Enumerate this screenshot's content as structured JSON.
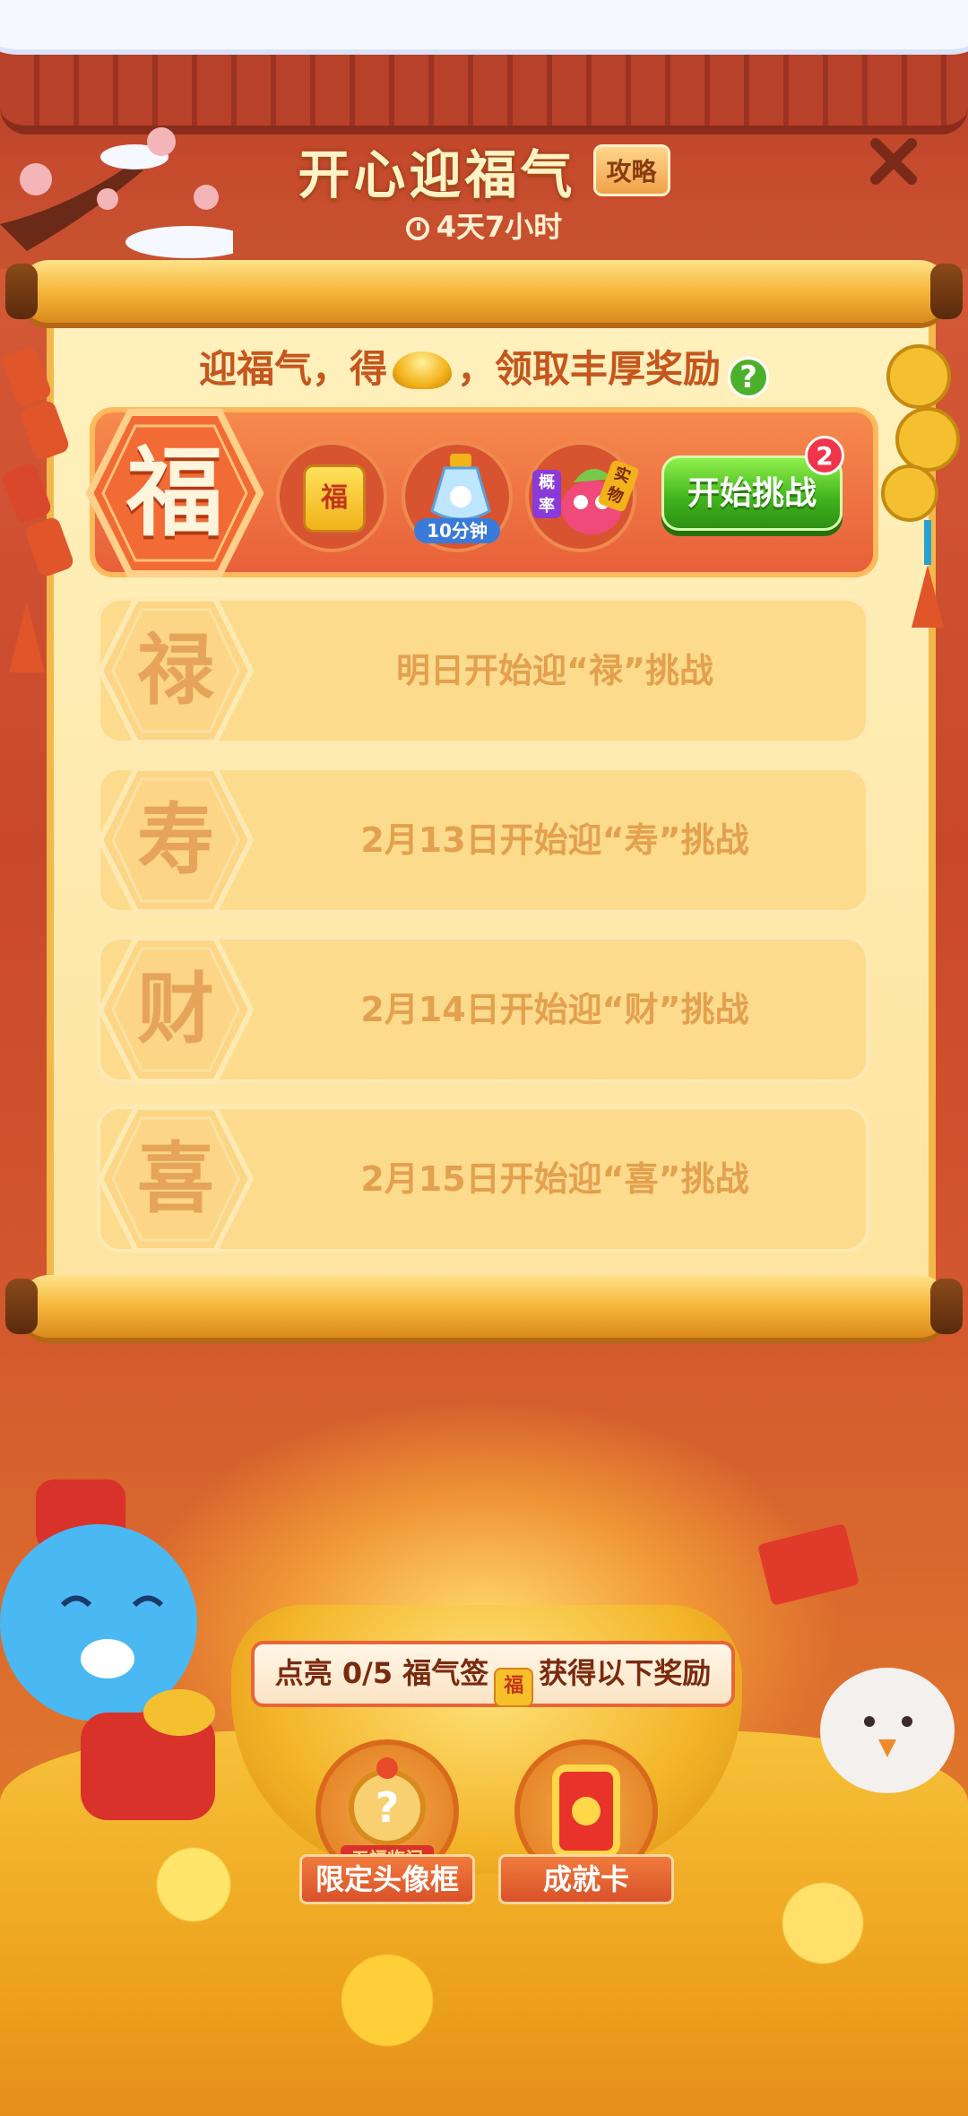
{
  "header": {
    "title": "开心迎福气",
    "guide_label": "攻略",
    "timer": "4天7小时",
    "close_icon": "close-icon"
  },
  "scroll": {
    "subtitle_before": "迎福气，得",
    "subtitle_after": "，领取丰厚奖励",
    "help_label": "?"
  },
  "active_challenge": {
    "character": "福",
    "rewards": [
      {
        "icon": "fu-card-icon",
        "label": "福"
      },
      {
        "icon": "potion-icon",
        "label": "10分钟"
      },
      {
        "icon": "lucky-chance-icon",
        "label_a": "概率",
        "label_b": "实物"
      }
    ],
    "start_button": "开始挑战",
    "badge_count": "2"
  },
  "upcoming": [
    {
      "character": "禄",
      "text": "明日开始迎“禄”挑战"
    },
    {
      "character": "寿",
      "text": "2月13日开始迎“寿”挑战"
    },
    {
      "character": "财",
      "text": "2月14日开始迎“财”挑战"
    },
    {
      "character": "喜",
      "text": "2月15日开始迎“喜”挑战"
    }
  ],
  "progress": {
    "prefix": "点亮",
    "count": "0/5",
    "item": "福气签",
    "mini_label": "福",
    "suffix": "获得以下奖励",
    "lit": 0,
    "total": 5
  },
  "prizes": [
    {
      "label": "限定头像框",
      "tag": "五福临门",
      "icon": "avatar-frame-icon"
    },
    {
      "label": "成就卡",
      "icon": "achievement-card-icon"
    }
  ],
  "colors": {
    "accent": "#e8603a",
    "start_green": "#3fb21c",
    "badge_red": "#f0354a",
    "locked_text": "#e3a04e"
  }
}
